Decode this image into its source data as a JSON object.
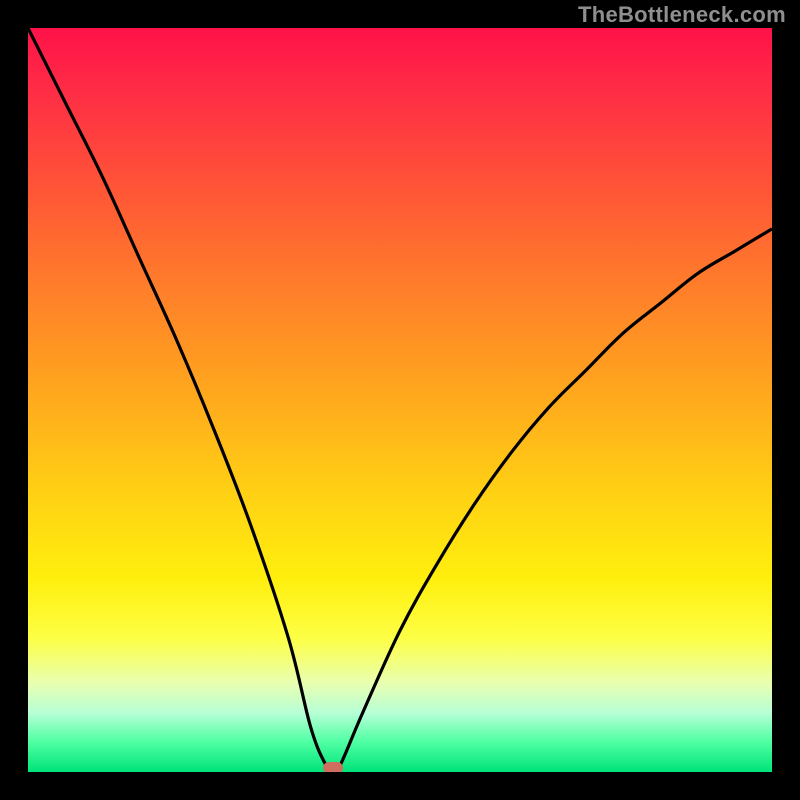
{
  "watermark": "TheBottleneck.com",
  "chart_data": {
    "type": "line",
    "title": "",
    "xlabel": "",
    "ylabel": "",
    "xlim": [
      0,
      100
    ],
    "ylim": [
      0,
      100
    ],
    "series": [
      {
        "name": "bottleneck-curve",
        "x": [
          0,
          5,
          10,
          15,
          20,
          25,
          30,
          35,
          38,
          40,
          41,
          42,
          45,
          50,
          55,
          60,
          65,
          70,
          75,
          80,
          85,
          90,
          95,
          100
        ],
        "y": [
          100,
          90,
          80,
          69,
          58,
          46,
          33,
          18,
          6,
          1,
          0,
          1,
          8,
          19,
          28,
          36,
          43,
          49,
          54,
          59,
          63,
          67,
          70,
          73
        ]
      }
    ],
    "marker": {
      "x": 41,
      "y": 0.5,
      "label": "optimal-point"
    },
    "background": "rainbow-gradient-red-to-green"
  },
  "colors": {
    "curve": "#000000",
    "marker": "#cf6e5e",
    "frame": "#000000"
  }
}
